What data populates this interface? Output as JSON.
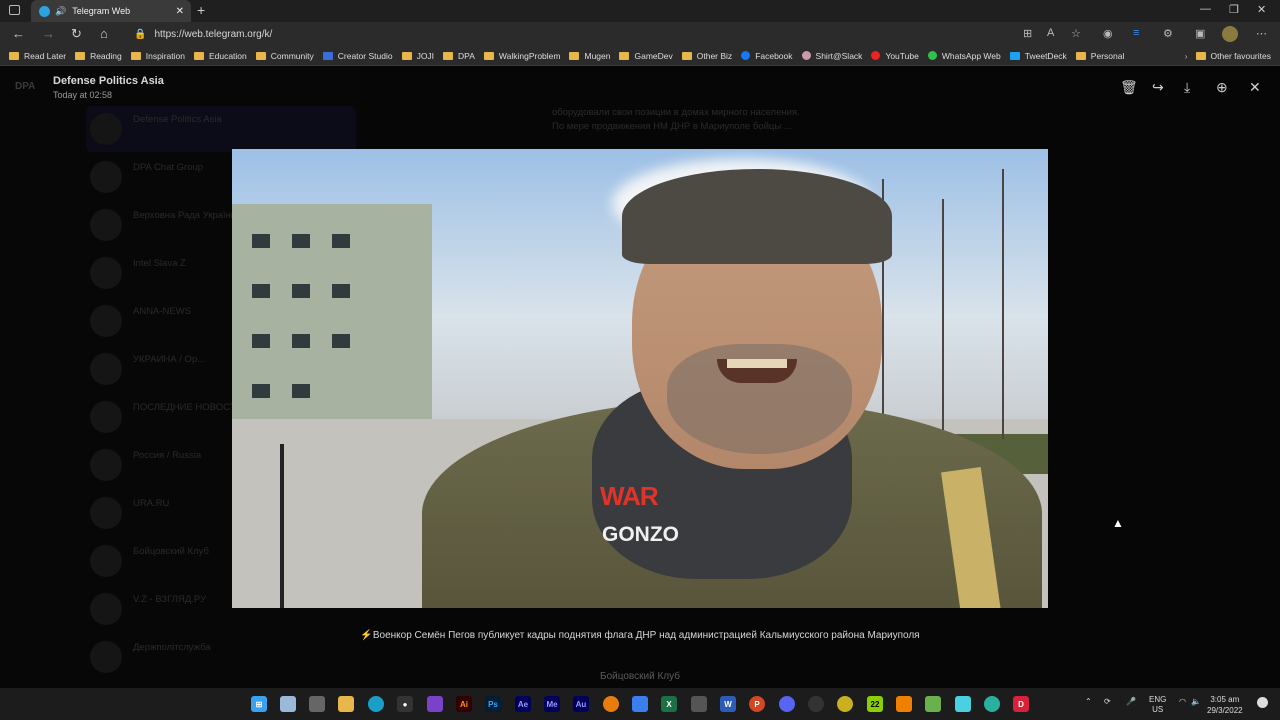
{
  "browser": {
    "tab_title": "Telegram Web",
    "new_tab": "+",
    "url": "https://web.telegram.org/k/",
    "window_controls": [
      "—",
      "❐",
      "✕"
    ]
  },
  "bookmarks": [
    {
      "label": "Read Later",
      "icon": "folder-icon"
    },
    {
      "label": "Reading",
      "icon": "folder-icon"
    },
    {
      "label": "Inspiration",
      "icon": "folder-icon"
    },
    {
      "label": "Education",
      "icon": "folder-icon"
    },
    {
      "label": "Community",
      "icon": "folder-icon"
    },
    {
      "label": "Creator Studio",
      "icon": "creator-studio-icon"
    },
    {
      "label": "JOJI",
      "icon": "folder-icon"
    },
    {
      "label": "DPA",
      "icon": "folder-icon"
    },
    {
      "label": "WalkingProblem",
      "icon": "folder-icon"
    },
    {
      "label": "Mugen",
      "icon": "folder-icon"
    },
    {
      "label": "GameDev",
      "icon": "folder-icon"
    },
    {
      "label": "Other Biz",
      "icon": "folder-icon"
    },
    {
      "label": "Facebook",
      "icon": "facebook-icon"
    },
    {
      "label": "Shirt@Slack",
      "icon": "slack-icon"
    },
    {
      "label": "YouTube",
      "icon": "youtube-icon"
    },
    {
      "label": "WhatsApp Web",
      "icon": "whatsapp-icon"
    },
    {
      "label": "TweetDeck",
      "icon": "tweetdeck-icon"
    },
    {
      "label": "Personal",
      "icon": "folder-icon"
    }
  ],
  "other_favourites": "Other favourites",
  "viewer": {
    "channel_name": "Defense Politics Asia",
    "timestamp": "Today at 02:58",
    "logo_text": "DPA",
    "caption": "⚡Военкор Семён Пегов публикует кадры поднятия флага ДНР над администрацией Кальмиусского района Мариуполя",
    "source": "Бойцовский Клуб",
    "watermark_top": "WAR",
    "watermark_bottom": "GONZO",
    "actions": [
      "delete-icon",
      "forward-icon",
      "download-icon",
      "zoom-icon",
      "close-icon"
    ]
  },
  "background_chats": [
    {
      "name": "Defense Politics Asia"
    },
    {
      "name": "DPA Chat Group"
    },
    {
      "name": "Верховна Рада України"
    },
    {
      "name": "Intel Slava Z"
    },
    {
      "name": "ANNA-NEWS"
    },
    {
      "name": "УКРАИНА / Ор..."
    },
    {
      "name": "ПОСЛЕДНИЕ НОВОСТИ"
    },
    {
      "name": "Россия / Russia"
    },
    {
      "name": "URA.RU"
    },
    {
      "name": "Бойцовский Клуб"
    },
    {
      "name": "V.Z - ВЗГЛЯД.РУ"
    },
    {
      "name": "Держполітслужба"
    }
  ],
  "background_message": "оборудовали свои позиции в домах мирного населения. По мере продвижения НМ ДНР в Мариуполе бойцы ...",
  "taskbar": {
    "lang_top": "ENG",
    "lang_bottom": "US",
    "time": "3:05 am",
    "date": "29/3/2022",
    "apps": [
      "windows-start-icon",
      "explorer-icon",
      "calculator-icon",
      "folder-icon",
      "edge-icon",
      "security-icon",
      "visual-studio-icon",
      "illustrator-icon",
      "photoshop-icon",
      "after-effects-icon",
      "media-encoder-icon",
      "audition-icon",
      "blender-icon",
      "docs-icon",
      "excel-icon",
      "word-icon",
      "powerpoint-icon",
      "discord-icon",
      "obs-icon",
      "app-icon",
      "22-app-icon",
      "vlc-icon",
      "notepad-icon",
      "notes-icon",
      "globe-icon",
      "d-app-icon"
    ],
    "app_labels": {
      "illustrator": "Ai",
      "photoshop": "Ps",
      "after_effects": "Ae",
      "media_encoder": "Me",
      "audition": "Au",
      "count": "22",
      "d_app": "D"
    }
  }
}
